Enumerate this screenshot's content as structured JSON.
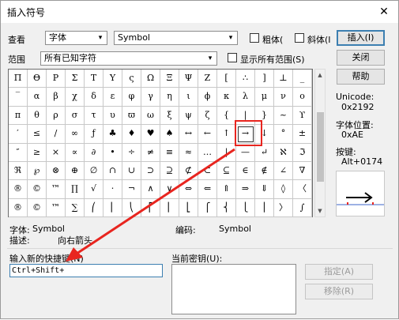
{
  "window": {
    "title": "插入符号",
    "close_glyph": "✕"
  },
  "font_label": "查看",
  "font_combo": {
    "value": "字体",
    "arrow": "▾"
  },
  "font_name_combo": {
    "value": "Symbol",
    "arrow": "▾"
  },
  "bold_label": "粗体(",
  "italic_label": "斜体(I",
  "range_label": "范围",
  "range_combo": {
    "value": "所有已知字符",
    "arrow": "▾"
  },
  "show_all_label": "显示所有范围(S)",
  "buttons": {
    "insert": "插入(I)",
    "close": "关闭",
    "help": "帮助",
    "assign": "指定(A)",
    "remove": "移除(R)"
  },
  "symbols": [
    [
      "Π",
      "Θ",
      "Ρ",
      "Σ",
      "Τ",
      "Υ",
      "ς",
      "Ω",
      "Ξ",
      "Ψ",
      "Ζ",
      "[",
      "∴",
      "]",
      "⊥",
      "_"
    ],
    [
      "‾",
      "α",
      "β",
      "χ",
      "δ",
      "ε",
      "φ",
      "γ",
      "η",
      "ι",
      "ϕ",
      "κ",
      "λ",
      "μ",
      "ν",
      "ο"
    ],
    [
      "π",
      "θ",
      "ρ",
      "σ",
      "τ",
      "υ",
      "ϖ",
      "ω",
      "ξ",
      "ψ",
      "ζ",
      "{",
      "|",
      "}",
      "~",
      "ϒ"
    ],
    [
      "′",
      "≤",
      "/",
      "∞",
      "ƒ",
      "♣",
      "♦",
      "♥",
      "♠",
      "↔",
      "←",
      "↑",
      "→",
      "↓",
      "°",
      "±"
    ],
    [
      "″",
      "≥",
      "×",
      "∝",
      "∂",
      "•",
      "÷",
      "≠",
      "≡",
      "≈",
      "…",
      "|",
      "—",
      "↵",
      "ℵ",
      "ℑ"
    ],
    [
      "ℜ",
      "℘",
      "⊗",
      "⊕",
      "∅",
      "∩",
      "∪",
      "⊃",
      "⊇",
      "⊄",
      "⊂",
      "⊆",
      "∈",
      "∉",
      "∠",
      "∇"
    ],
    [
      "®",
      "©",
      "™",
      "∏",
      "√",
      "⋅",
      "¬",
      "∧",
      "∨",
      "⇔",
      "⇐",
      "⇑",
      "⇒",
      "⇓",
      "◊",
      "〈"
    ],
    [
      "®",
      "©",
      "™",
      "∑",
      "⎛",
      "⎜",
      "⎝",
      "⎡",
      "⎢",
      "⎣",
      "⎧",
      "⎨",
      "⎩",
      "⎪",
      "〉",
      "∫"
    ]
  ],
  "unicode_label": "Unicode:",
  "unicode_value": "0x2192",
  "font_pos_label": "字体位置:",
  "font_pos_value": "0xAE",
  "shortcut_label": "按键:",
  "shortcut_value": "Alt+0174",
  "preview_glyph": "→",
  "info": {
    "font_label": "字体:",
    "font_value": "Symbol",
    "encoding_label": "编码:",
    "encoding_value": "Symbol",
    "desc_label": "描述:",
    "desc_value": "向右箭头"
  },
  "new_shortcut_label": "输入新的快捷键(N)",
  "new_shortcut_value": "Ctrl+Shift+",
  "current_keys_label": "当前密钥(U):",
  "annotation_color": "#e8251f"
}
